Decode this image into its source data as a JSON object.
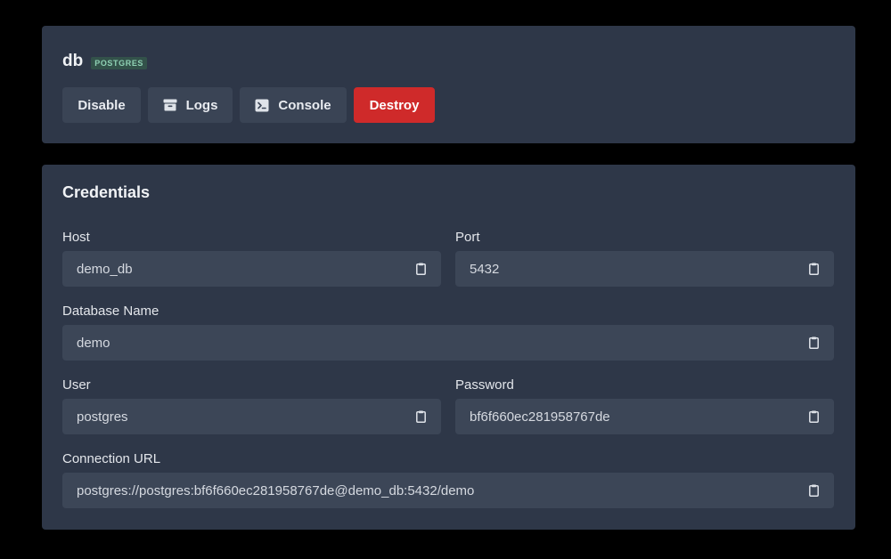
{
  "service": {
    "name": "db",
    "badge": "POSTGRES"
  },
  "actions": {
    "disable": "Disable",
    "logs": "Logs",
    "console": "Console",
    "destroy": "Destroy"
  },
  "icons": {
    "logs": "archive-icon",
    "console": "terminal-icon",
    "copy": "clipboard-icon"
  },
  "colors": {
    "background": "#000000",
    "card": "#2e3748",
    "field": "#3c4657",
    "button": "#3a4455",
    "danger": "#cf2a2a",
    "badge_bg": "#33524a",
    "badge_text": "#8fd1b4"
  },
  "credentials": {
    "title": "Credentials",
    "host": {
      "label": "Host",
      "value": "demo_db"
    },
    "port": {
      "label": "Port",
      "value": "5432"
    },
    "database_name": {
      "label": "Database Name",
      "value": "demo"
    },
    "user": {
      "label": "User",
      "value": "postgres"
    },
    "password": {
      "label": "Password",
      "value": "bf6f660ec281958767de"
    },
    "connection_url": {
      "label": "Connection URL",
      "value": "postgres://postgres:bf6f660ec281958767de@demo_db:5432/demo"
    }
  }
}
